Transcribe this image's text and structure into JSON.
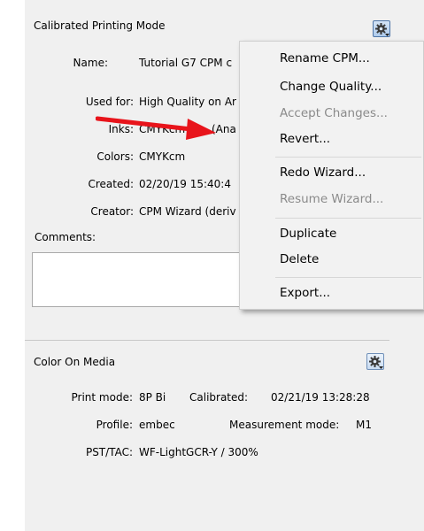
{
  "cpm": {
    "title": "Calibrated Printing Mode",
    "name_label": "Name:",
    "name_value": "Tutorial G7 CPM c",
    "used_for_label": "Used for:",
    "used_for_value": "High Quality on Ar",
    "inks_label": "Inks:",
    "inks_value": "CMYKcm",
    "inks_suffix": "(Ana",
    "colors_label": "Colors:",
    "colors_value": "CMYKcm",
    "created_label": "Created:",
    "created_value": "02/20/19 15:40:4",
    "creator_label": "Creator:",
    "creator_value": "CPM Wizard (deriv",
    "comments_label": "Comments:",
    "gear_icon": "gear-dropdown-icon"
  },
  "context_menu": {
    "items": [
      {
        "label": "Rename CPM...",
        "enabled": true
      },
      {
        "label": "Change Quality...",
        "enabled": true
      },
      {
        "label": "Accept Changes...",
        "enabled": false
      },
      {
        "label": "Revert...",
        "enabled": true
      },
      {
        "label": "Redo Wizard...",
        "enabled": true
      },
      {
        "label": "Resume Wizard...",
        "enabled": false
      },
      {
        "label": "Duplicate",
        "enabled": true
      },
      {
        "label": "Delete",
        "enabled": true
      },
      {
        "label": "Export...",
        "enabled": true
      }
    ]
  },
  "com": {
    "title": "Color On Media",
    "print_mode_label": "Print mode:",
    "print_mode_value": "8P Bi",
    "calibrated_label": "Calibrated:",
    "calibrated_value": "02/21/19 13:28:28",
    "profile_label": "Profile:",
    "profile_value": "embec",
    "measurement_label": "Measurement mode:",
    "measurement_value": "M1",
    "pst_label": "PST/TAC:",
    "pst_value": "WF-LightGCR-Y / 300%"
  },
  "annotation": {
    "arrow_color": "#e8141b",
    "icon": "red-arrow-icon"
  }
}
